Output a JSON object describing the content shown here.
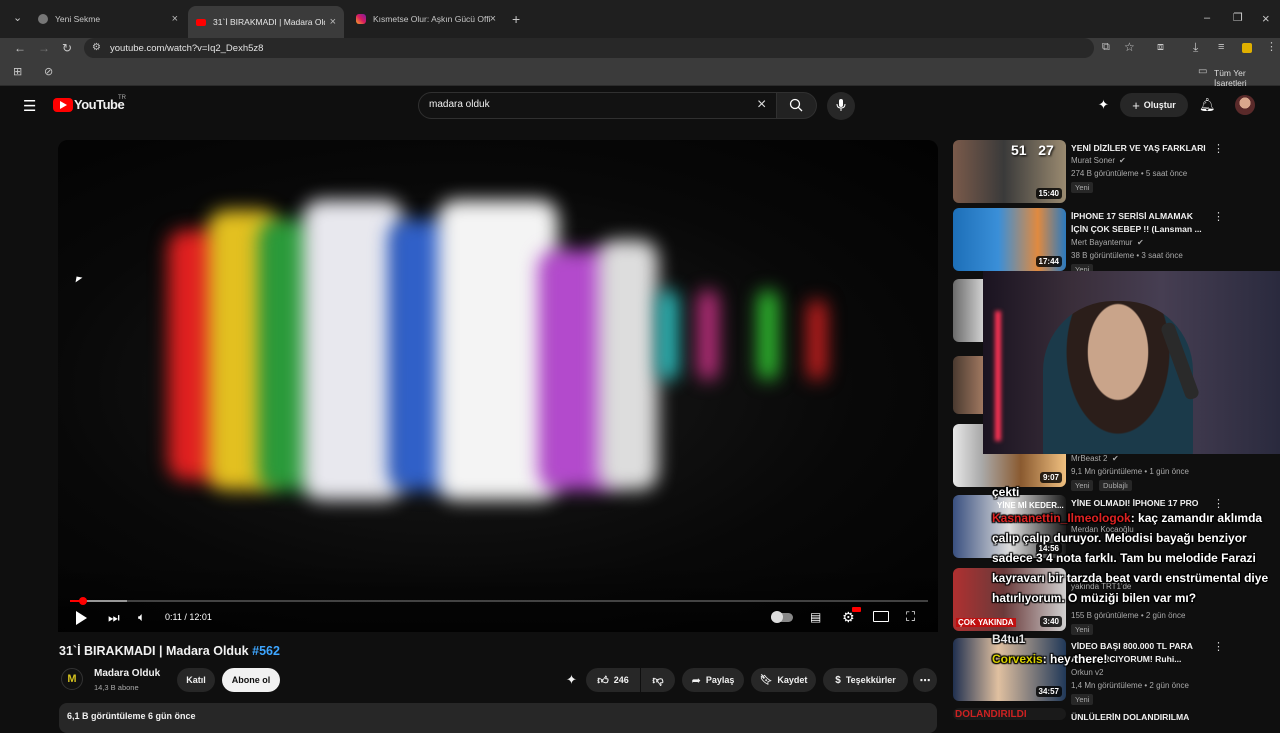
{
  "browser": {
    "tabs": [
      {
        "title": "Yeni Sekme"
      },
      {
        "title": "31`İ BIRAKMADI | Madara Olduk"
      },
      {
        "title": "Kısmetse Olur: Aşkın Gücü Offi"
      }
    ],
    "url": "youtube.com/watch?v=Iq2_Dexh5z8",
    "bookmarks_label": "Tüm Yer İşaretleri"
  },
  "youtube": {
    "logo_text": "YouTube",
    "country": "TR",
    "search_value": "madara olduk",
    "create_label": "Oluştur"
  },
  "player": {
    "time_current": "0:11",
    "time_total": "12:01",
    "time_display": "0:11 / 12:01",
    "progress_fraction": 0.0153,
    "buffered_fraction": 0.066
  },
  "video": {
    "title": "31`İ BIRAKMADI | Madara Olduk",
    "hashtag": "#562",
    "channel": "Madara Olduk",
    "subscribers": "14,3 B abone",
    "join_label": "Katıl",
    "subscribe_label": "Abone ol",
    "likes": "246",
    "share_label": "Paylaş",
    "save_label": "Kaydet",
    "thanks_label": "Teşekkürler",
    "desc_meta": "6,1 B görüntüleme  6 gün önce"
  },
  "sidebar": [
    {
      "title": "YENİ DİZİLER VE YAŞ FARKLARI",
      "channel": "Murat Soner",
      "meta": "274 B görüntüleme • 5 saat önce",
      "badge": "Yeni",
      "duration": "15:40",
      "thumb_text": "51   27"
    },
    {
      "title": "İPHONE 17 SERİSİ ALMAMAK İÇİN ÇOK SEBEP !! (Lansman ...",
      "channel": "Mert Bayantemur",
      "meta": "38 B görüntüleme • 3 saat önce",
      "badge": "Yeni",
      "duration": "17:44"
    },
    {
      "title": "",
      "channel": "MrBeast 2",
      "meta": "9,1 Mn görüntüleme • 1 gün önce",
      "badge": "Yeni",
      "badge2": "Dublajlı",
      "duration": "9:07"
    },
    {
      "title": "YİNE OLMADI! İPHONE 17 PRO",
      "channel": "Merdan Kocaoğlu",
      "meta": "",
      "duration": "14:56",
      "thumb_text": "YİNE Mİ KEDER..."
    },
    {
      "title": "",
      "channel": "",
      "meta": "155 B görüntüleme • 2 gün önce",
      "badge": "Yeni",
      "duration": "3:40",
      "thumb_text": "ÇOK YAKINDA"
    },
    {
      "title": "VİDEO BAŞI 800.000 TL PARA ALA HARCIYORUM! Ruhi...",
      "channel": "Orkun v2",
      "meta": "1,4 Mn görüntüleme • 2 gün önce",
      "badge": "Yeni",
      "duration": "34:57"
    },
    {
      "title": "ÜNLÜLERİN DOLANDIRILMA",
      "thumb_text": "DOLANDIRILDI"
    }
  ],
  "overlay": {
    "chat_word": "çekti",
    "chat1_user": "Kasnanettin_Ilmeologok",
    "chat1_text": ": kaç zamandır aklımda çalıp çalıp duruyor. Melodisi bayağı benziyor sadece 3 4 nota farklı. Tam bu melodide Farazi kayravarı bir tarzda beat vardı enstrümental diye hatırlıyorum. O müziği bilen var mı?",
    "chat2_user": "B4tu1",
    "chat2_user2": "Corvexis",
    "chat2_text": ": hey there!",
    "overlay_tag1": "yakında TRT1'de"
  },
  "colors": {
    "background": "#0f0f0f",
    "accent_red": "#ff0000",
    "link_blue": "#3ea6ff"
  }
}
